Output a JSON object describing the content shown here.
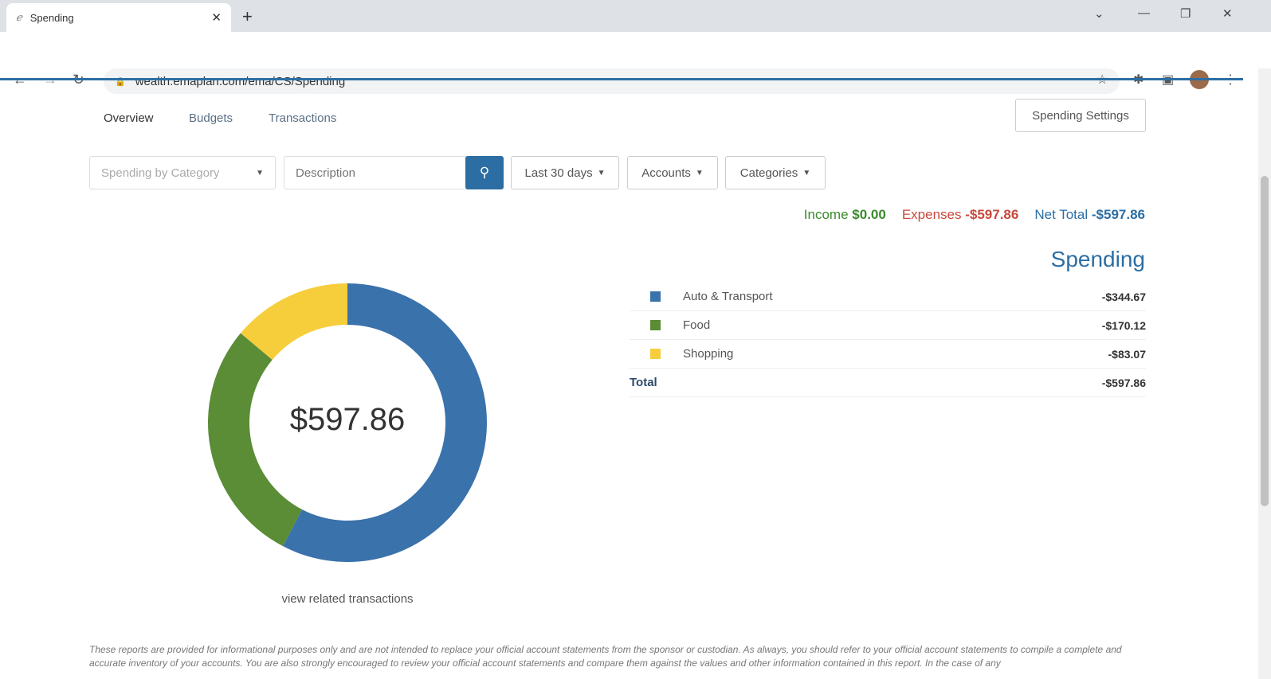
{
  "browser": {
    "tab_title": "Spending",
    "url": "wealth.emaplan.com/ema/CS/Spending"
  },
  "page_tabs": [
    "Overview",
    "Budgets",
    "Transactions"
  ],
  "settings_button": "Spending Settings",
  "filters": {
    "view": "Spending by Category",
    "description_placeholder": "Description",
    "date": "Last 30 days",
    "accounts": "Accounts",
    "categories": "Categories"
  },
  "summary": {
    "income_label": "Income",
    "income": "$0.00",
    "expenses_label": "Expenses",
    "expenses": "-$597.86",
    "net_label": "Net Total",
    "net": "-$597.86"
  },
  "spending_title": "Spending",
  "center_total": "$597.86",
  "view_link": "view related transactions",
  "colors": {
    "blue": "#3a72ab",
    "green": "#5b8c36",
    "yellow": "#f6cd3b",
    "income": "#3c8a2e",
    "expense": "#c9483c"
  },
  "chart_data": {
    "type": "pie",
    "title": "Spending",
    "categories": [
      "Auto & Transport",
      "Food",
      "Shopping"
    ],
    "values": [
      344.67,
      170.12,
      83.07
    ],
    "colors": [
      "#3a72ab",
      "#5b8c36",
      "#f6cd3b"
    ]
  },
  "legend": {
    "items": [
      {
        "name": "Auto & Transport",
        "value": "-$344.67"
      },
      {
        "name": "Food",
        "value": "-$170.12"
      },
      {
        "name": "Shopping",
        "value": "-$83.07"
      }
    ],
    "total_label": "Total",
    "total": "-$597.86"
  },
  "footer": "These reports are provided for informational purposes only and are not intended to replace your official account statements from the sponsor or custodian. As always, you should refer to your official account statements to compile a complete and accurate inventory of your accounts. You are also strongly encouraged to review your official account statements and compare them against the values and other information contained in this report. In the case of any"
}
